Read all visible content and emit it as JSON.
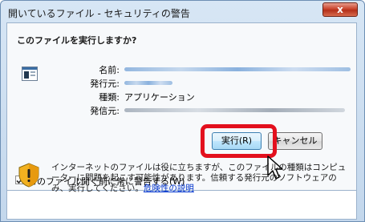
{
  "window": {
    "title": "開いているファイル - セキュリティの警告",
    "close_label": "x"
  },
  "dialog": {
    "question": "このファイルを実行しますか?",
    "fields": [
      {
        "label": "名前:",
        "value": ""
      },
      {
        "label": "発行元:",
        "value": ""
      },
      {
        "label": "種類:",
        "value": "アプリケーション"
      },
      {
        "label": "発信元:",
        "value": ""
      }
    ],
    "run_button": "実行(R)",
    "cancel_button": "キャンセル",
    "checkbox_label": "このファイル開く前に常に警告する(W)",
    "checkbox_checked": true,
    "warning_text": "インターネットのファイルは役に立ちますが、このファイルの種類はコンピューターに問題を起こす可能性があります。信頼する発行元のソフトウェアのみ、実行してください。",
    "warning_link": "危険性の説明"
  },
  "colors": {
    "highlight": "#e3101d",
    "link": "#0033cc"
  },
  "icons": [
    "application-file-icon",
    "arrow-cursor-icon",
    "shield-warning-icon",
    "close-icon"
  ]
}
